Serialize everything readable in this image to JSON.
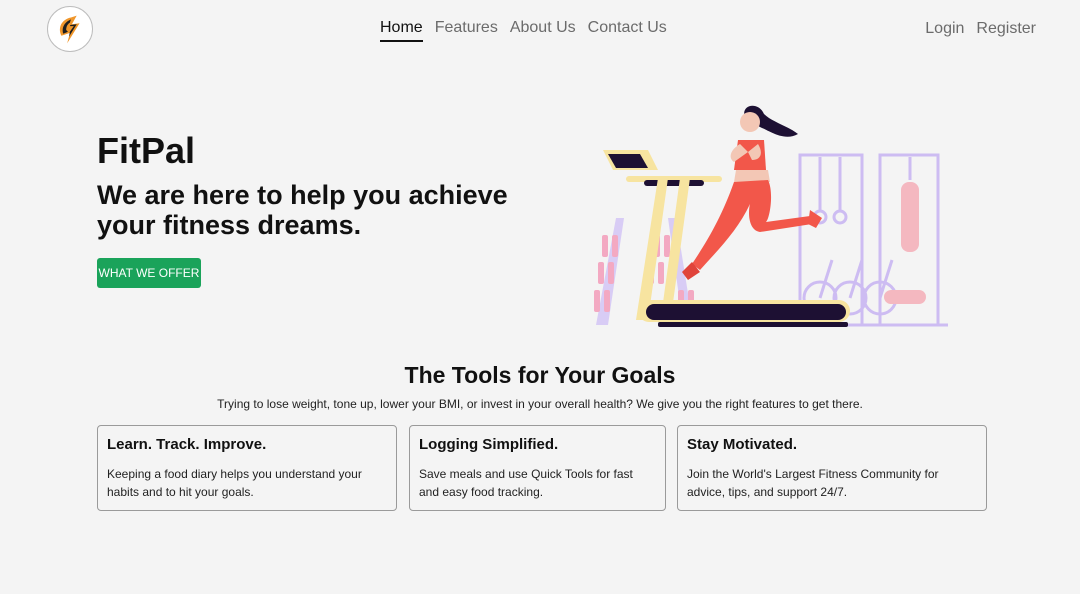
{
  "header": {
    "logo_icon": "lightning-bolt-icon",
    "nav": [
      {
        "label": "Home",
        "active": true
      },
      {
        "label": "Features",
        "active": false
      },
      {
        "label": "About Us",
        "active": false
      },
      {
        "label": "Contact Us",
        "active": false
      }
    ],
    "auth": {
      "login": "Login",
      "register": "Register"
    }
  },
  "hero": {
    "title": "FitPal",
    "subtitle": "We are here to help you achieve your fitness dreams.",
    "cta_label": "WHAT WE OFFER",
    "cta_color": "#1aa35a",
    "illustration": "treadmill-runner-illustration"
  },
  "tools": {
    "title": "The Tools for Your Goals",
    "description": "Trying to lose weight, tone up, lower your BMI, or invest in your overall health? We give you the right features to get there.",
    "cards": [
      {
        "title": "Learn. Track. Improve.",
        "text": "Keeping a food diary helps you understand your habits and to hit your goals."
      },
      {
        "title": "Logging Simplified.",
        "text": "Save meals and use Quick Tools for fast and easy food tracking."
      },
      {
        "title": "Stay Motivated.",
        "text": "Join the World's Largest Fitness Community for advice, tips, and support 24/7."
      }
    ]
  },
  "colors": {
    "background": "#f4f4f4",
    "accent_green": "#1aa35a",
    "logo_orange": "#f0962a",
    "illustration_coral": "#f2574a",
    "illustration_yellow": "#f7e4a0",
    "illustration_lavender": "#c9b8f0"
  }
}
